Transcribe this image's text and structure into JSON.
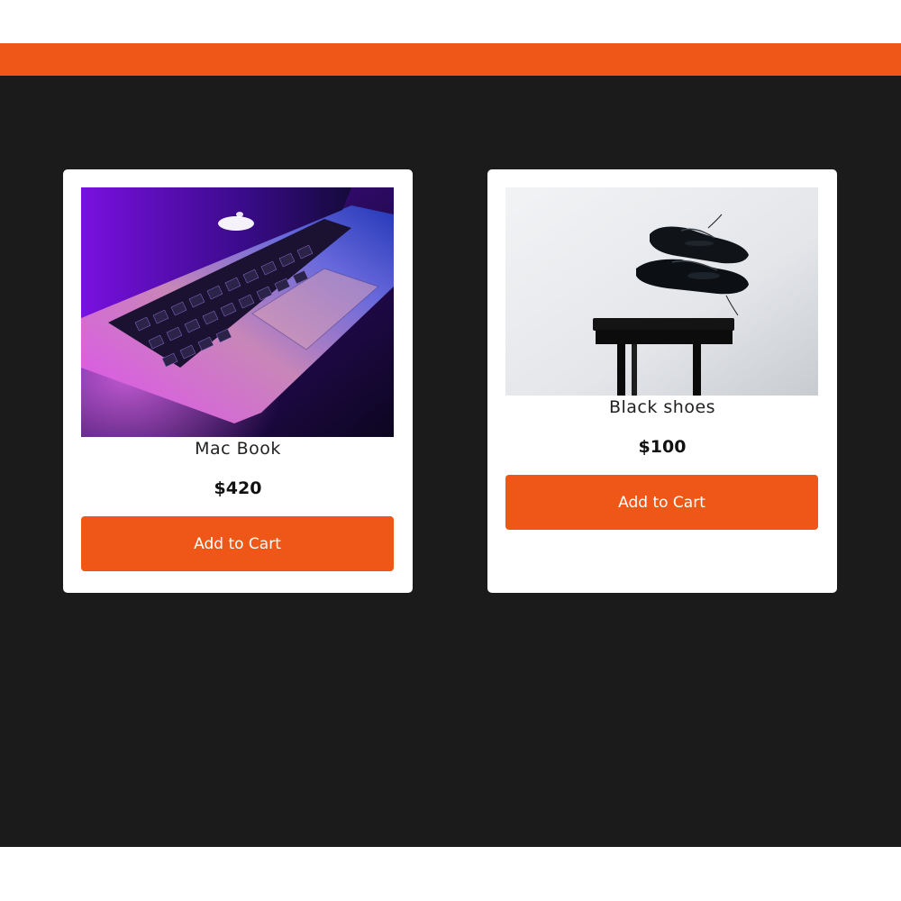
{
  "theme": {
    "accent": "#ee5717",
    "background": "#1b1b1b",
    "card": "#ffffff"
  },
  "products": [
    {
      "name": "Mac Book",
      "price": "$420",
      "button_label": "Add to Cart",
      "image": "laptop-photo"
    },
    {
      "name": "Black shoes",
      "price": "$100",
      "button_label": "Add to Cart",
      "image": "shoes-on-stool-photo"
    }
  ]
}
